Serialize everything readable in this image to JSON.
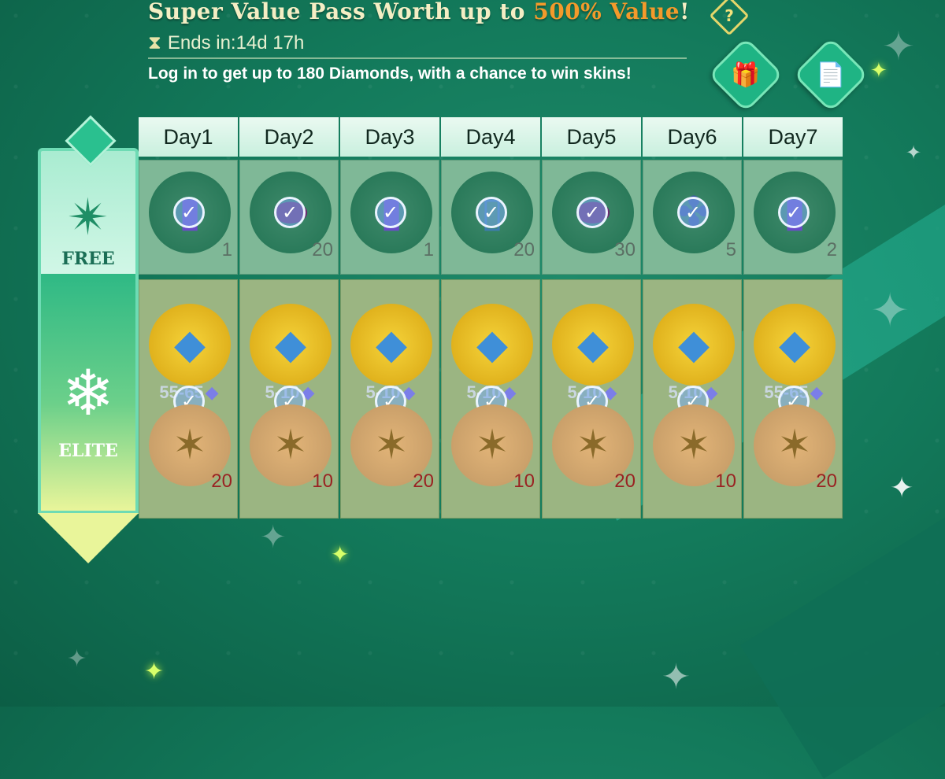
{
  "header": {
    "title_part1": "Super Value Pass Worth up to ",
    "title_highlight": "500% Value",
    "title_part3": "!",
    "help_label": "?",
    "timer": "Ends in:14d  17h",
    "description": "Log in to get up to 180 Diamonds, with a chance to win skins!"
  },
  "buttons": {
    "gift_icon": "gift-icon",
    "rules_icon": "document-icon"
  },
  "tracks": {
    "free_label": "FREE",
    "elite_label": "ELITE"
  },
  "days": [
    {
      "label": "Day1",
      "free_icon": "🎫",
      "free_qty": "1",
      "elite_range": "55-65",
      "elite_qty": "20",
      "elite_orb": "gold"
    },
    {
      "label": "Day2",
      "free_icon": "⬬",
      "free_qty": "20",
      "elite_range": "5-10",
      "elite_qty": "10",
      "elite_orb": "gold"
    },
    {
      "label": "Day3",
      "free_icon": "🎫",
      "free_qty": "1",
      "elite_range": "5-10",
      "elite_qty": "20",
      "elite_orb": "gold"
    },
    {
      "label": "Day4",
      "free_icon": "▮",
      "free_qty": "20",
      "elite_range": "5-10",
      "elite_qty": "10",
      "elite_orb": "gold"
    },
    {
      "label": "Day5",
      "free_icon": "⬬",
      "free_qty": "30",
      "elite_range": "5-10",
      "elite_qty": "20",
      "elite_orb": "gold"
    },
    {
      "label": "Day6",
      "free_icon": "🧩",
      "free_qty": "5",
      "elite_range": "5-10",
      "elite_qty": "10",
      "elite_orb": "gold"
    },
    {
      "label": "Day7",
      "free_icon": "🎫",
      "free_qty": "2",
      "elite_range": "55-65",
      "elite_qty": "20",
      "elite_orb": "gold"
    }
  ],
  "colors": {
    "accent_orange": "#f39a2b",
    "title_cream": "#f4eec4",
    "claimed_check": "#eaf4ff"
  }
}
